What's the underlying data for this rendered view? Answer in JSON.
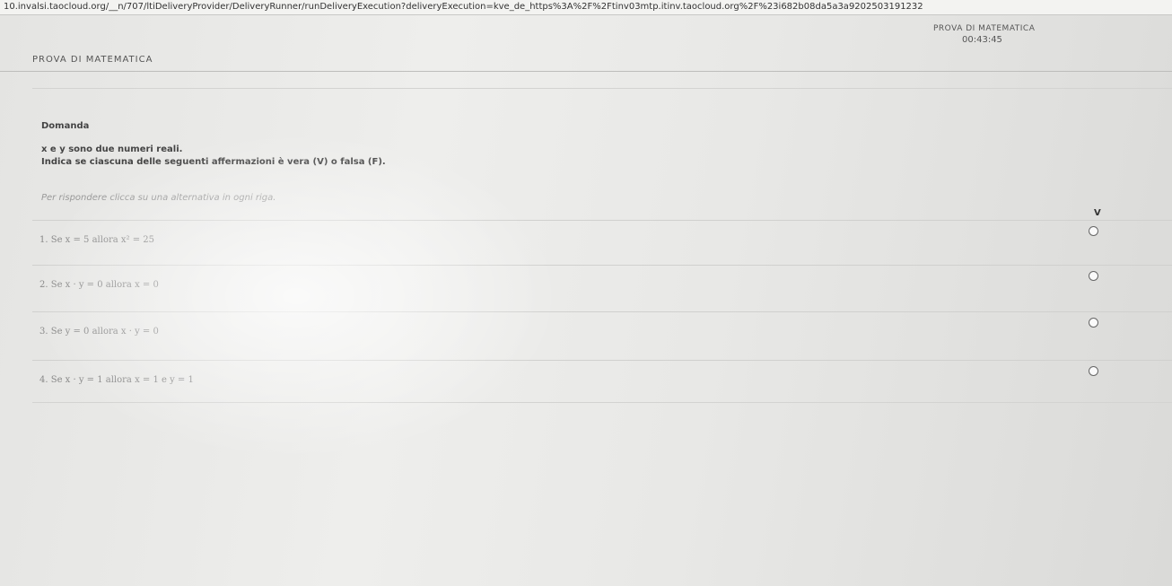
{
  "browser": {
    "url": "10.invalsi.taocloud.org/__n/707/ltiDeliveryProvider/DeliveryRunner/runDeliveryExecution?deliveryExecution=kve_de_https%3A%2F%2Ftinv03mtp.itinv.taocloud.org%2F%23i682b08da5a3a9202503191232"
  },
  "header": {
    "title": "PROVA DI MATEMATICA",
    "test_name": "PROVA DI MATEMATICA",
    "timer": "00:43:45"
  },
  "question": {
    "section_label": "Domanda",
    "stem_line1": "x e y sono due numeri reali.",
    "stem_line2": "Indica se ciascuna delle seguenti affermazioni è vera (V) o falsa (F).",
    "instruction": "Per rispondere clicca su una alternativa in ogni riga.",
    "column_header": "V",
    "statements": [
      {
        "text": "1. Se x = 5 allora x² = 25"
      },
      {
        "text": "2. Se x · y = 0 allora x = 0"
      },
      {
        "text": "3. Se y = 0 allora x · y = 0"
      },
      {
        "text": "4. Se x · y = 1 allora x = 1 e y = 1"
      }
    ]
  }
}
